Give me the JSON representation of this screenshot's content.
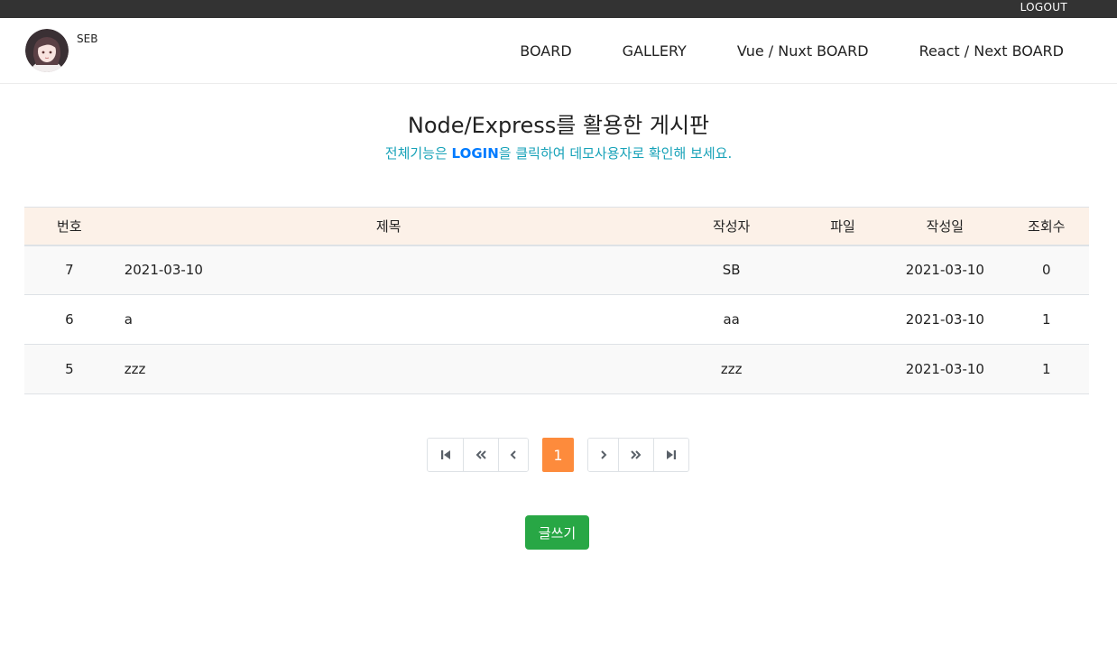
{
  "topbar": {
    "logout_label": "LOGOUT"
  },
  "header": {
    "brand_name": "SEB",
    "nav": [
      {
        "label": "BOARD"
      },
      {
        "label": "GALLERY"
      },
      {
        "label": "Vue / Nuxt BOARD"
      },
      {
        "label": "React / Next BOARD"
      }
    ]
  },
  "main": {
    "title": "Node/Express를 활용한 게시판",
    "subtitle_before": "전체기능은 ",
    "subtitle_link": "LOGIN",
    "subtitle_after": "을 클릭하여 데모사용자로 확인해 보세요."
  },
  "table": {
    "headers": {
      "num": "번호",
      "title": "제목",
      "writer": "작성자",
      "file": "파일",
      "date": "작성일",
      "views": "조회수"
    },
    "rows": [
      {
        "num": "7",
        "title": "2021-03-10",
        "writer": "SB",
        "file": "",
        "date": "2021-03-10",
        "views": "0"
      },
      {
        "num": "6",
        "title": "a",
        "writer": "aa",
        "file": "",
        "date": "2021-03-10",
        "views": "1"
      },
      {
        "num": "5",
        "title": "zzz",
        "writer": "zzz",
        "file": "",
        "date": "2021-03-10",
        "views": "1"
      }
    ]
  },
  "pagination": {
    "current_page": "1",
    "icons": [
      "first-page-icon",
      "prev-block-icon",
      "prev-page-icon",
      "next-page-icon",
      "next-block-icon",
      "last-page-icon"
    ],
    "active_color": "#fd8b3c"
  },
  "actions": {
    "write_label": "글쓰기",
    "write_color": "#28a745"
  }
}
